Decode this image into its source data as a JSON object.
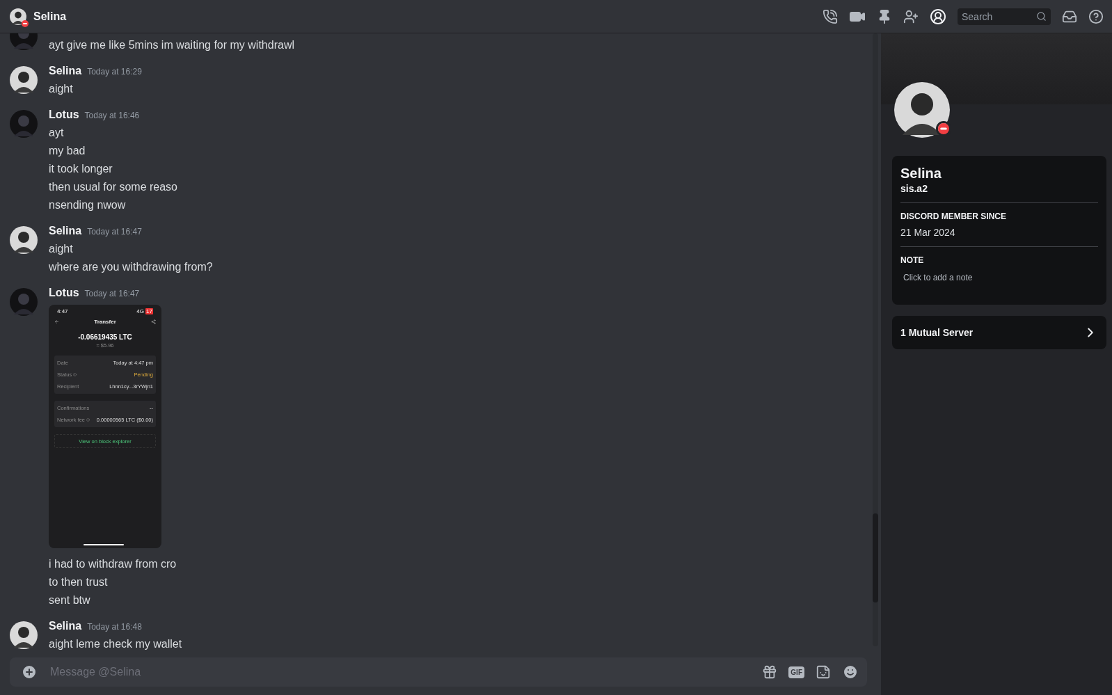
{
  "header": {
    "name": "Selina",
    "dnd": true,
    "search_placeholder": "Search"
  },
  "messages": [
    {
      "dark_avatar": true,
      "items": [
        {
          "kind": "text",
          "text": "ayt give me like 5mins im waiting for my withdrawl"
        }
      ]
    },
    {
      "author": "Selina",
      "dark_avatar": false,
      "time": "Today at 16:29",
      "items": [
        {
          "kind": "text",
          "text": "aight"
        }
      ]
    },
    {
      "author": "Lotus",
      "dark_avatar": true,
      "time": "Today at 16:46",
      "items": [
        {
          "kind": "text",
          "text": "ayt"
        },
        {
          "kind": "text",
          "text": "my bad"
        },
        {
          "kind": "text",
          "text": "it took longer"
        },
        {
          "kind": "text",
          "text": "then usual for some reaso"
        },
        {
          "kind": "text",
          "text": "nsending nwow"
        }
      ]
    },
    {
      "author": "Selina",
      "dark_avatar": false,
      "time": "Today at 16:47",
      "items": [
        {
          "kind": "text",
          "text": "aight"
        },
        {
          "kind": "text",
          "text": "where are you withdrawing from?"
        }
      ]
    },
    {
      "author": "Lotus",
      "dark_avatar": true,
      "time": "Today at 16:47",
      "items": [
        {
          "kind": "screenshot",
          "time": "4:47",
          "network": "4G",
          "battery": "17",
          "title": "Transfer",
          "amount": "-0.06619435 LTC",
          "fiat": "≈ $5.96",
          "groups": [
            [
              {
                "label": "Date",
                "value": "Today at 4:47 pm",
                "info": false,
                "highlight": false
              },
              {
                "label": "Status",
                "value": "Pending",
                "info": true,
                "highlight": true
              },
              {
                "label": "Recipient",
                "value": "Lhnn1cy...3rYWjn1",
                "info": false,
                "highlight": false
              }
            ],
            [
              {
                "label": "Confirmations",
                "value": "--",
                "info": false,
                "highlight": false
              },
              {
                "label": "Network fee",
                "value": "0.00000565 LTC ($0.00)",
                "info": true,
                "highlight": false
              }
            ]
          ],
          "link": "View on block explorer"
        },
        {
          "kind": "text",
          "text": "i had to withdraw from cro"
        },
        {
          "kind": "text",
          "text": "to then trust"
        },
        {
          "kind": "text",
          "text": "sent btw"
        }
      ]
    },
    {
      "author": "Selina",
      "dark_avatar": false,
      "time": "Today at 16:48",
      "items": [
        {
          "kind": "text",
          "text": "aight leme check my wallet"
        }
      ]
    }
  ],
  "composer": {
    "placeholder": "Message @Selina",
    "gif_label": "GIF"
  },
  "profile": {
    "dnd": true,
    "display_name": "Selina",
    "username": "sis.a2",
    "sections": [
      {
        "kind": "info",
        "heading": "DISCORD MEMBER SINCE",
        "value": "21 Mar 2024"
      },
      {
        "kind": "note",
        "heading": "NOTE",
        "placeholder": "Click to add a note"
      }
    ],
    "mutual": "1 Mutual Server"
  }
}
